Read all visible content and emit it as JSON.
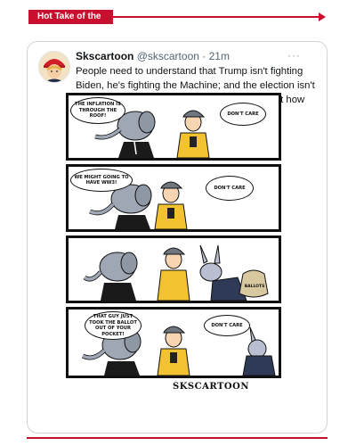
{
  "banner": {
    "label": "Hot Take of the Day"
  },
  "tweet": {
    "author": "Skscartoon",
    "handle": "@skscartoon",
    "separator": "·",
    "time": "21m",
    "more": "···",
    "text": "People need to understand that Trump isn't fighting Biden, he's fighting the Machine; and the election isn't about how many people support you,  it's about how many ballots you can harvest."
  },
  "comic": {
    "panel1": {
      "left_bubble": "THE INFLATION IS THROUGH THE ROOF!",
      "right_bubble": "DON'T CARE"
    },
    "panel2": {
      "left_bubble": "WE MIGHT GOING TO HAVE WW3!",
      "right_bubble": "DON'T CARE"
    },
    "panel3": {
      "sack_label": "BALLOTS"
    },
    "panel4": {
      "left_bubble": "THAT GUY JUST TOOK THE BALLOT OUT OF YOUR POCKET!",
      "right_bubble": "DON'T CARE"
    },
    "signature": "SKSCARTOON"
  },
  "colors": {
    "accent_red": "#c8102e",
    "border_gray": "#d4d4d4",
    "handle_gray": "#536471",
    "jacket_yellow": "#f2c230",
    "cap_gray": "#6f7680",
    "elephant_gray": "#9ea7b3",
    "donkey_gray": "#b9bfd0"
  }
}
